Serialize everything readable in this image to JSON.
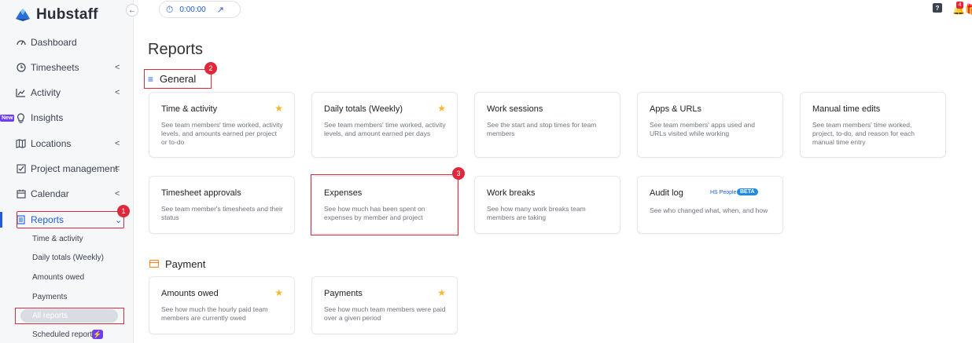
{
  "app": {
    "name": "Hubstaff"
  },
  "sidebar": {
    "items": [
      {
        "label": "Dashboard",
        "icon": "dashboard-icon"
      },
      {
        "label": "Timesheets",
        "icon": "clock-icon"
      },
      {
        "label": "Activity",
        "icon": "activity-icon"
      },
      {
        "label": "Insights",
        "icon": "bulb-icon",
        "badge": "New"
      },
      {
        "label": "Locations",
        "icon": "map-icon"
      },
      {
        "label": "Project management",
        "icon": "checkbox-icon"
      },
      {
        "label": "Calendar",
        "icon": "calendar-icon"
      },
      {
        "label": "Reports",
        "icon": "report-icon"
      }
    ],
    "subitems": [
      {
        "label": "Time & activity"
      },
      {
        "label": "Daily totals (Weekly)"
      },
      {
        "label": "Amounts owed"
      },
      {
        "label": "Payments"
      },
      {
        "label": "All reports"
      },
      {
        "label": "Scheduled reports"
      }
    ]
  },
  "timer": {
    "value": "0:00:00"
  },
  "notifications": {
    "count": "4"
  },
  "page": {
    "title": "Reports"
  },
  "sections": {
    "general": {
      "title": "General",
      "cards": [
        {
          "title": "Time & activity",
          "desc": "See team members' time worked, activity levels, and amounts earned per project or to-do",
          "starred": true
        },
        {
          "title": "Daily totals (Weekly)",
          "desc": "See team members' time worked, activity levels, and amount earned per days",
          "starred": true
        },
        {
          "title": "Work sessions",
          "desc": "See the start and stop times for team members",
          "starred": false
        },
        {
          "title": "Apps & URLs",
          "desc": "See team members' apps used and URLs visited while working",
          "starred": false
        },
        {
          "title": "Manual time edits",
          "desc": "See team members' time worked, project, to-do, and reason for each manual time entry",
          "starred": false
        },
        {
          "title": "Timesheet approvals",
          "desc": "See team member's timesheets and their status",
          "starred": false
        },
        {
          "title": "Expenses",
          "desc": "See how much has been spent on expenses by member and project",
          "starred": false
        },
        {
          "title": "Work breaks",
          "desc": "See how many work breaks team members are taking",
          "starred": false
        },
        {
          "title": "Audit log",
          "desc": "See who changed what, when, and how",
          "starred": false,
          "tag": "HS People",
          "badge": "BETA"
        }
      ]
    },
    "payment": {
      "title": "Payment",
      "cards": [
        {
          "title": "Amounts owed",
          "desc": "See how much the hourly paid team members are currently owed",
          "starred": true
        },
        {
          "title": "Payments",
          "desc": "See how much team members were paid over a given period",
          "starred": true
        }
      ]
    }
  },
  "annotations": [
    "1",
    "2",
    "3"
  ],
  "colors": {
    "accent": "#1e5bd6",
    "highlight": "#e0283d",
    "star": "#f5b82e",
    "new_badge": "#6b3df5"
  }
}
